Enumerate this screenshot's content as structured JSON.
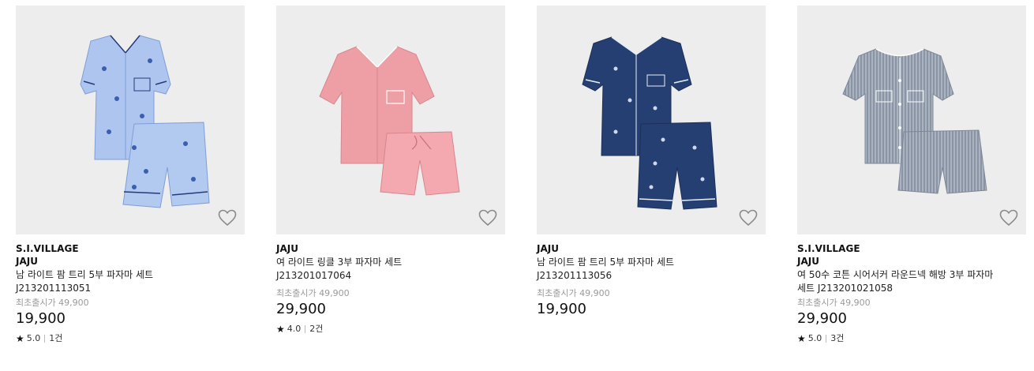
{
  "products": [
    {
      "mall_label": "S.I.VILLAGE",
      "brand": "JAJU",
      "name": "남 라이트 팜 트리 5부 파자마 세트",
      "code": "J213201113051",
      "original_price": "최초출시가 49,900",
      "price": "19,900",
      "rating": "5.0",
      "reviews": "1건",
      "image": "light-blue-palm-pajama-set",
      "color": "#aec6ef"
    },
    {
      "brand": "JAJU",
      "name": "여 라이트 링클 3부 파자마 세트",
      "code": "J213201017064",
      "original_price": "최초출시가 49,900",
      "price": "29,900",
      "rating": "4.0",
      "reviews": "2건",
      "image": "pink-wrinkle-pajama-set",
      "color": "#ee9fa6"
    },
    {
      "brand": "JAJU",
      "name": "남 라이트 팜 트리 5부 파자마 세트",
      "code": "J213201113056",
      "original_price": "최초출시가 49,900",
      "price": "19,900",
      "image": "navy-palm-pajama-set",
      "color": "#263f72"
    },
    {
      "mall_label": "S.I.VILLAGE",
      "brand": "JAJU",
      "name": "여 50수 코튼 시어서커 라운드넥 해방 3부 파자마 세트 J213201021058",
      "original_price": "최초출시가 49,900",
      "price": "29,900",
      "rating": "5.0",
      "reviews": "3건",
      "image": "gray-seersucker-pajama-set",
      "color": "#9aa3b1"
    }
  ],
  "icons": {
    "wishlist": "heart-outline-icon",
    "rating": "star-icon"
  }
}
